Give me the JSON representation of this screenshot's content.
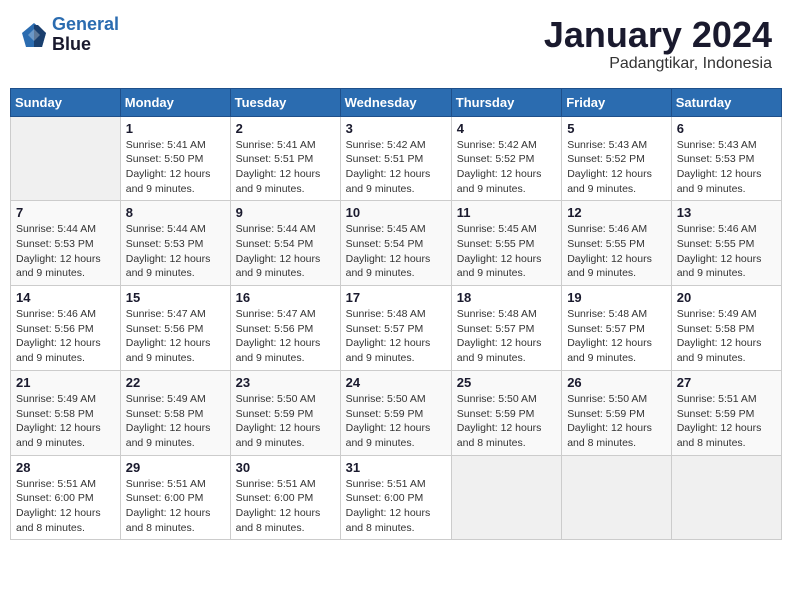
{
  "header": {
    "logo_line1": "General",
    "logo_line2": "Blue",
    "month_year": "January 2024",
    "location": "Padangtikar, Indonesia"
  },
  "weekdays": [
    "Sunday",
    "Monday",
    "Tuesday",
    "Wednesday",
    "Thursday",
    "Friday",
    "Saturday"
  ],
  "weeks": [
    [
      {
        "day": "",
        "info": ""
      },
      {
        "day": "1",
        "info": "Sunrise: 5:41 AM\nSunset: 5:50 PM\nDaylight: 12 hours\nand 9 minutes."
      },
      {
        "day": "2",
        "info": "Sunrise: 5:41 AM\nSunset: 5:51 PM\nDaylight: 12 hours\nand 9 minutes."
      },
      {
        "day": "3",
        "info": "Sunrise: 5:42 AM\nSunset: 5:51 PM\nDaylight: 12 hours\nand 9 minutes."
      },
      {
        "day": "4",
        "info": "Sunrise: 5:42 AM\nSunset: 5:52 PM\nDaylight: 12 hours\nand 9 minutes."
      },
      {
        "day": "5",
        "info": "Sunrise: 5:43 AM\nSunset: 5:52 PM\nDaylight: 12 hours\nand 9 minutes."
      },
      {
        "day": "6",
        "info": "Sunrise: 5:43 AM\nSunset: 5:53 PM\nDaylight: 12 hours\nand 9 minutes."
      }
    ],
    [
      {
        "day": "7",
        "info": "Sunrise: 5:44 AM\nSunset: 5:53 PM\nDaylight: 12 hours\nand 9 minutes."
      },
      {
        "day": "8",
        "info": "Sunrise: 5:44 AM\nSunset: 5:53 PM\nDaylight: 12 hours\nand 9 minutes."
      },
      {
        "day": "9",
        "info": "Sunrise: 5:44 AM\nSunset: 5:54 PM\nDaylight: 12 hours\nand 9 minutes."
      },
      {
        "day": "10",
        "info": "Sunrise: 5:45 AM\nSunset: 5:54 PM\nDaylight: 12 hours\nand 9 minutes."
      },
      {
        "day": "11",
        "info": "Sunrise: 5:45 AM\nSunset: 5:55 PM\nDaylight: 12 hours\nand 9 minutes."
      },
      {
        "day": "12",
        "info": "Sunrise: 5:46 AM\nSunset: 5:55 PM\nDaylight: 12 hours\nand 9 minutes."
      },
      {
        "day": "13",
        "info": "Sunrise: 5:46 AM\nSunset: 5:55 PM\nDaylight: 12 hours\nand 9 minutes."
      }
    ],
    [
      {
        "day": "14",
        "info": "Sunrise: 5:46 AM\nSunset: 5:56 PM\nDaylight: 12 hours\nand 9 minutes."
      },
      {
        "day": "15",
        "info": "Sunrise: 5:47 AM\nSunset: 5:56 PM\nDaylight: 12 hours\nand 9 minutes."
      },
      {
        "day": "16",
        "info": "Sunrise: 5:47 AM\nSunset: 5:56 PM\nDaylight: 12 hours\nand 9 minutes."
      },
      {
        "day": "17",
        "info": "Sunrise: 5:48 AM\nSunset: 5:57 PM\nDaylight: 12 hours\nand 9 minutes."
      },
      {
        "day": "18",
        "info": "Sunrise: 5:48 AM\nSunset: 5:57 PM\nDaylight: 12 hours\nand 9 minutes."
      },
      {
        "day": "19",
        "info": "Sunrise: 5:48 AM\nSunset: 5:57 PM\nDaylight: 12 hours\nand 9 minutes."
      },
      {
        "day": "20",
        "info": "Sunrise: 5:49 AM\nSunset: 5:58 PM\nDaylight: 12 hours\nand 9 minutes."
      }
    ],
    [
      {
        "day": "21",
        "info": "Sunrise: 5:49 AM\nSunset: 5:58 PM\nDaylight: 12 hours\nand 9 minutes."
      },
      {
        "day": "22",
        "info": "Sunrise: 5:49 AM\nSunset: 5:58 PM\nDaylight: 12 hours\nand 9 minutes."
      },
      {
        "day": "23",
        "info": "Sunrise: 5:50 AM\nSunset: 5:59 PM\nDaylight: 12 hours\nand 9 minutes."
      },
      {
        "day": "24",
        "info": "Sunrise: 5:50 AM\nSunset: 5:59 PM\nDaylight: 12 hours\nand 9 minutes."
      },
      {
        "day": "25",
        "info": "Sunrise: 5:50 AM\nSunset: 5:59 PM\nDaylight: 12 hours\nand 8 minutes."
      },
      {
        "day": "26",
        "info": "Sunrise: 5:50 AM\nSunset: 5:59 PM\nDaylight: 12 hours\nand 8 minutes."
      },
      {
        "day": "27",
        "info": "Sunrise: 5:51 AM\nSunset: 5:59 PM\nDaylight: 12 hours\nand 8 minutes."
      }
    ],
    [
      {
        "day": "28",
        "info": "Sunrise: 5:51 AM\nSunset: 6:00 PM\nDaylight: 12 hours\nand 8 minutes."
      },
      {
        "day": "29",
        "info": "Sunrise: 5:51 AM\nSunset: 6:00 PM\nDaylight: 12 hours\nand 8 minutes."
      },
      {
        "day": "30",
        "info": "Sunrise: 5:51 AM\nSunset: 6:00 PM\nDaylight: 12 hours\nand 8 minutes."
      },
      {
        "day": "31",
        "info": "Sunrise: 5:51 AM\nSunset: 6:00 PM\nDaylight: 12 hours\nand 8 minutes."
      },
      {
        "day": "",
        "info": ""
      },
      {
        "day": "",
        "info": ""
      },
      {
        "day": "",
        "info": ""
      }
    ]
  ]
}
